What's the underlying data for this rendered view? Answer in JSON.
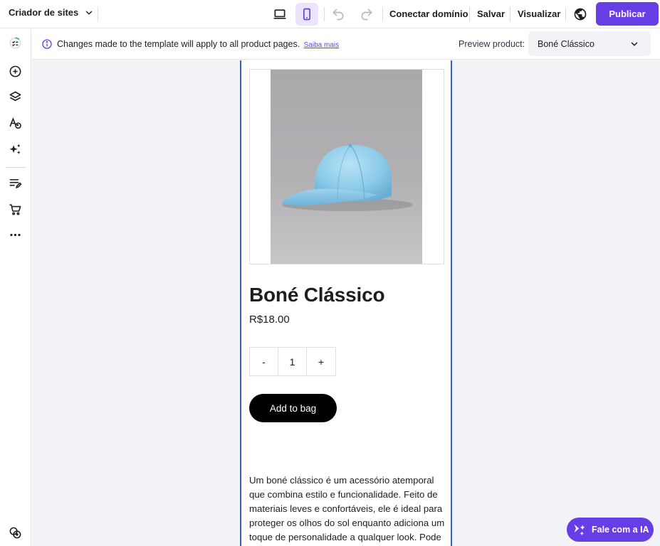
{
  "topbar": {
    "brand_label": "Criador de sites",
    "connect_domain_label": "Conectar domínio",
    "save_label": "Salvar",
    "preview_label": "Visualizar",
    "publish_label": "Publicar",
    "active_device": "mobile",
    "accent_color": "#673de6"
  },
  "sidebar": {
    "icons": [
      "progress-checklist-icon",
      "add-icon",
      "layers-icon",
      "styles-icon",
      "ai-tools-icon",
      "blog-icon",
      "store-cart-icon",
      "more-icon",
      "help-icon"
    ]
  },
  "infobar": {
    "message": "Changes made to the template will apply to all product pages.",
    "link_label": "Saiba mais",
    "preview_product_label": "Preview product:",
    "preview_product_value": "Boné Clássico"
  },
  "product": {
    "title": "Boné Clássico",
    "price": "R$18.00",
    "quantity": "1",
    "minus_label": "-",
    "plus_label": "+",
    "add_to_bag_label": "Add to bag",
    "description": "Um boné clássico é um acessório atemporal que combina estilo e funcionalidade. Feito de materiais leves e confortáveis, ele é ideal para proteger os olhos do sol enquanto adiciona um toque de personalidade a qualquer look. Pode"
  },
  "chat": {
    "label": "Fale com a IA"
  }
}
